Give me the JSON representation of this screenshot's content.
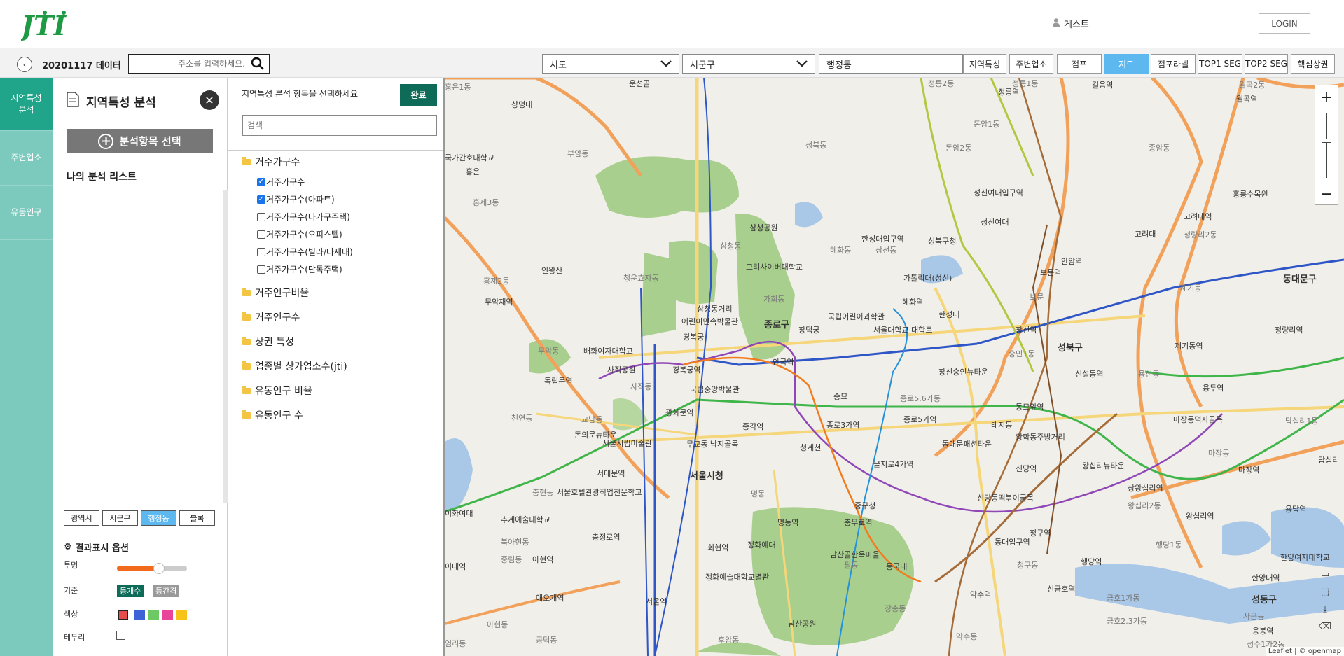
{
  "header": {
    "logo_text": "JTI",
    "guest_label": "게스트",
    "login_label": "LOGIN"
  },
  "toolbar": {
    "data_label": "20201117 데이터",
    "search_placeholder": "주소를 입력하세요.",
    "sido_value": "시도",
    "sigungu_value": "시군구",
    "dong_value": "행정동",
    "buttons": [
      "지역특성",
      "주변업소",
      "점포",
      "지도",
      "점포라벨",
      "TOP1 SEG",
      "TOP2 SEG",
      "핵심상권"
    ],
    "active_button": "지도"
  },
  "leftnav": {
    "items": [
      "지역특성 분석",
      "주변업소",
      "유동인구"
    ],
    "active": "지역특성 분석"
  },
  "panel": {
    "title": "지역특성 분석",
    "add_button": "분석항목 선택",
    "mylist_label": "나의 분석 리스트",
    "level_tabs": [
      "광역시",
      "시군구",
      "행정동",
      "블록"
    ],
    "active_level": "행정동",
    "options_title": "결과표시 옵션",
    "opacity_label": "투명",
    "opacity_value": 0.6,
    "basis_label": "기준",
    "basis_options": [
      "등개수",
      "등간격"
    ],
    "color_label": "색상",
    "colors": [
      "#e74c4c",
      "#3e63d6",
      "#6cc964",
      "#e8449a",
      "#f7c21a"
    ],
    "edge_label": "테두리"
  },
  "selector": {
    "prompt": "지역특성 분석 항목을 선택하세요",
    "done_label": "완료",
    "search_placeholder": "검색",
    "folders": [
      {
        "label": "거주가구수",
        "expanded": true,
        "children": [
          {
            "label": "거주가구수",
            "checked": true
          },
          {
            "label": "거주가구수(아파트)",
            "checked": true
          },
          {
            "label": "거주가구수(다가구주택)",
            "checked": false
          },
          {
            "label": "거주가구수(오피스텔)",
            "checked": false
          },
          {
            "label": "거주가구수(빌라/다세대)",
            "checked": false
          },
          {
            "label": "거주가구수(단독주택)",
            "checked": false
          }
        ]
      },
      {
        "label": "거주인구비율"
      },
      {
        "label": "거주인구수"
      },
      {
        "label": "상권 특성"
      },
      {
        "label": "업종별 상가업소수(jti)"
      },
      {
        "label": "유동인구 비율"
      },
      {
        "label": "유동인구 수"
      }
    ]
  },
  "map": {
    "labels": [
      {
        "t": "운선골",
        "c": ""
      },
      {
        "t": "정릉2동",
        "c": "gray"
      },
      {
        "t": "정릉1동",
        "c": "gray"
      },
      {
        "t": "정릉역",
        "c": ""
      },
      {
        "t": "길음역",
        "c": ""
      },
      {
        "t": "월곡2동",
        "c": "gray"
      },
      {
        "t": "월곡역",
        "c": ""
      },
      {
        "t": "홍은1동",
        "c": "gray"
      },
      {
        "t": "상명대",
        "c": ""
      },
      {
        "t": "부암동",
        "c": "gray"
      },
      {
        "t": "성북동",
        "c": "gray"
      },
      {
        "t": "돈암1동",
        "c": "gray"
      },
      {
        "t": "돈암2동",
        "c": "gray"
      },
      {
        "t": "종암동",
        "c": "gray"
      },
      {
        "t": "국가간호대학교",
        "c": ""
      },
      {
        "t": "홍은",
        "c": ""
      },
      {
        "t": "홍제3동",
        "c": "gray"
      },
      {
        "t": "성신여대입구역",
        "c": ""
      },
      {
        "t": "홍릉수목원",
        "c": ""
      },
      {
        "t": "삼청공원",
        "c": ""
      },
      {
        "t": "성신여대",
        "c": ""
      },
      {
        "t": "고려대역",
        "c": ""
      },
      {
        "t": "고려대",
        "c": ""
      },
      {
        "t": "청량리2동",
        "c": "gray"
      },
      {
        "t": "한성대입구역",
        "c": ""
      },
      {
        "t": "성북구청",
        "c": ""
      },
      {
        "t": "삼선동",
        "c": "gray"
      },
      {
        "t": "혜화동",
        "c": "gray"
      },
      {
        "t": "삼청동",
        "c": "gray"
      },
      {
        "t": "인왕산",
        "c": ""
      },
      {
        "t": "고려사이버대학교",
        "c": ""
      },
      {
        "t": "안암역",
        "c": ""
      },
      {
        "t": "보문역",
        "c": ""
      },
      {
        "t": "홍제2동",
        "c": "gray"
      },
      {
        "t": "청운효자동",
        "c": "gray"
      },
      {
        "t": "가톨릭대(성신)",
        "c": ""
      },
      {
        "t": "동대문구",
        "c": "big"
      },
      {
        "t": "무악재역",
        "c": ""
      },
      {
        "t": "가회동",
        "c": "gray"
      },
      {
        "t": "제기동",
        "c": "gray"
      },
      {
        "t": "삼청동거리",
        "c": ""
      },
      {
        "t": "혜화역",
        "c": ""
      },
      {
        "t": "보문",
        "c": "gray"
      },
      {
        "t": "어린이민속박물관",
        "c": ""
      },
      {
        "t": "종로구",
        "c": "big"
      },
      {
        "t": "국립어린이과학관",
        "c": ""
      },
      {
        "t": "한성대",
        "c": ""
      },
      {
        "t": "경복궁",
        "c": ""
      },
      {
        "t": "창덕궁",
        "c": ""
      },
      {
        "t": "서울대학교 대학로",
        "c": ""
      },
      {
        "t": "창신역",
        "c": ""
      },
      {
        "t": "청량리역",
        "c": ""
      },
      {
        "t": "무악동",
        "c": "gray"
      },
      {
        "t": "배화여자대학교",
        "c": ""
      },
      {
        "t": "숭인1동",
        "c": "gray"
      },
      {
        "t": "성북구",
        "c": "big"
      },
      {
        "t": "제기동역",
        "c": ""
      },
      {
        "t": "사직공원",
        "c": ""
      },
      {
        "t": "경복궁역",
        "c": ""
      },
      {
        "t": "안국역",
        "c": ""
      },
      {
        "t": "창신숭인뉴타운",
        "c": ""
      },
      {
        "t": "신설동역",
        "c": ""
      },
      {
        "t": "용신동",
        "c": "gray"
      },
      {
        "t": "독립문역",
        "c": ""
      },
      {
        "t": "사직동",
        "c": "gray"
      },
      {
        "t": "국립중앙박물관",
        "c": ""
      },
      {
        "t": "종묘",
        "c": ""
      },
      {
        "t": "용두역",
        "c": ""
      },
      {
        "t": "종로5.6가동",
        "c": "gray"
      },
      {
        "t": "동묘앞역",
        "c": ""
      },
      {
        "t": "천연동",
        "c": "gray"
      },
      {
        "t": "교남동",
        "c": "gray"
      },
      {
        "t": "광화문역",
        "c": ""
      },
      {
        "t": "종각역",
        "c": ""
      },
      {
        "t": "종로3가역",
        "c": ""
      },
      {
        "t": "종로5가역",
        "c": ""
      },
      {
        "t": "테지동",
        "c": ""
      },
      {
        "t": "황학동주방거리",
        "c": ""
      },
      {
        "t": "마장동먹자골목",
        "c": ""
      },
      {
        "t": "답십리1동",
        "c": "gray"
      },
      {
        "t": "돈의문뉴타운",
        "c": ""
      },
      {
        "t": "서울시립미술관",
        "c": ""
      },
      {
        "t": "무교동 낙지골목",
        "c": ""
      },
      {
        "t": "청계천",
        "c": ""
      },
      {
        "t": "동대문패션타운",
        "c": ""
      },
      {
        "t": "마장동",
        "c": "gray"
      },
      {
        "t": "을지로4가역",
        "c": ""
      },
      {
        "t": "신당역",
        "c": ""
      },
      {
        "t": "왕십리뉴타운",
        "c": ""
      },
      {
        "t": "마장역",
        "c": ""
      },
      {
        "t": "서대문역",
        "c": ""
      },
      {
        "t": "서울시청",
        "c": "big"
      },
      {
        "t": "충현동",
        "c": "gray"
      },
      {
        "t": "서울호텔관광직업전문학교",
        "c": ""
      },
      {
        "t": "명동",
        "c": "gray"
      },
      {
        "t": "상왕십리역",
        "c": ""
      },
      {
        "t": "답십리",
        "c": ""
      },
      {
        "t": "중구청",
        "c": ""
      },
      {
        "t": "신당동떡볶이골목",
        "c": ""
      },
      {
        "t": "이화여대",
        "c": ""
      },
      {
        "t": "추계예술대학교",
        "c": ""
      },
      {
        "t": "명동역",
        "c": ""
      },
      {
        "t": "충무로역",
        "c": ""
      },
      {
        "t": "왕십리2동",
        "c": "gray"
      },
      {
        "t": "왕십리역",
        "c": ""
      },
      {
        "t": "용답역",
        "c": ""
      },
      {
        "t": "북아현동",
        "c": "gray"
      },
      {
        "t": "충정로역",
        "c": ""
      },
      {
        "t": "정화예대",
        "c": ""
      },
      {
        "t": "동대입구역",
        "c": ""
      },
      {
        "t": "청구역",
        "c": ""
      },
      {
        "t": "행당1동",
        "c": "gray"
      },
      {
        "t": "회현역",
        "c": ""
      },
      {
        "t": "남산골한옥마을",
        "c": ""
      },
      {
        "t": "동국대",
        "c": ""
      },
      {
        "t": "중림동",
        "c": "gray"
      },
      {
        "t": "아현역",
        "c": ""
      },
      {
        "t": "필동",
        "c": "gray"
      },
      {
        "t": "청구동",
        "c": "gray"
      },
      {
        "t": "행당역",
        "c": ""
      },
      {
        "t": "한양여자대학교",
        "c": ""
      },
      {
        "t": "이대역",
        "c": ""
      },
      {
        "t": "정화예술대학교별관",
        "c": ""
      },
      {
        "t": "신금호역",
        "c": ""
      },
      {
        "t": "한양대역",
        "c": ""
      },
      {
        "t": "애오개역",
        "c": ""
      },
      {
        "t": "서울역",
        "c": ""
      },
      {
        "t": "약수역",
        "c": ""
      },
      {
        "t": "금호1가동",
        "c": "gray"
      },
      {
        "t": "성동구",
        "c": "big"
      },
      {
        "t": "아현동",
        "c": "gray"
      },
      {
        "t": "장충동",
        "c": "gray"
      },
      {
        "t": "남산공원",
        "c": ""
      },
      {
        "t": "금호2.3가동",
        "c": "gray"
      },
      {
        "t": "응봉역",
        "c": ""
      },
      {
        "t": "공덕동",
        "c": "gray"
      },
      {
        "t": "후암동",
        "c": "gray"
      },
      {
        "t": "약수동",
        "c": "gray"
      },
      {
        "t": "사근동",
        "c": "gray"
      },
      {
        "t": "염리동",
        "c": "gray"
      },
      {
        "t": "성수1가2동",
        "c": "gray"
      }
    ],
    "attribution": "Leaflet | © openmap"
  }
}
